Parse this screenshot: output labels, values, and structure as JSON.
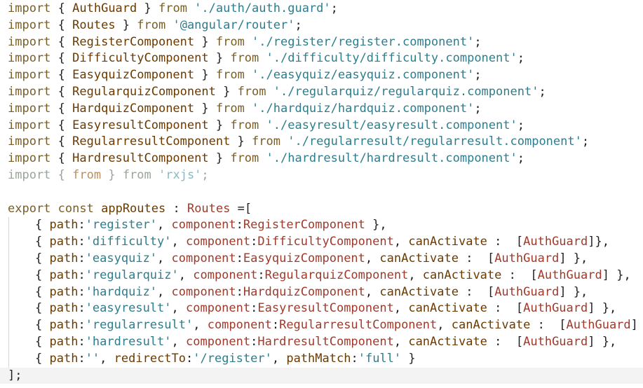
{
  "lines": [
    {
      "kind": "import",
      "keyword": "import",
      "open": " { ",
      "name": "AuthGuard",
      "close": " } ",
      "from": "from",
      "path": " './auth/auth.guard'",
      "end": ";"
    },
    {
      "kind": "import",
      "keyword": "import",
      "open": " { ",
      "name": "Routes",
      "close": " } ",
      "from": "from",
      "path": " '@angular/router'",
      "end": ";"
    },
    {
      "kind": "import",
      "keyword": "import",
      "open": " { ",
      "name": "RegisterComponent",
      "close": " } ",
      "from": "from",
      "path": " './register/register.component'",
      "end": ";"
    },
    {
      "kind": "import",
      "keyword": "import",
      "open": " { ",
      "name": "DifficultyComponent",
      "close": " } ",
      "from": "from",
      "path": " './difficulty/difficulty.component'",
      "end": ";"
    },
    {
      "kind": "import",
      "keyword": "import",
      "open": " { ",
      "name": "EasyquizComponent",
      "close": " } ",
      "from": "from",
      "path": " './easyquiz/easyquiz.component'",
      "end": ";"
    },
    {
      "kind": "import",
      "keyword": "import",
      "open": " { ",
      "name": "RegularquizComponent",
      "close": " } ",
      "from": "from",
      "path": " './regularquiz/regularquiz.component'",
      "end": ";"
    },
    {
      "kind": "import",
      "keyword": "import",
      "open": " { ",
      "name": "HardquizComponent",
      "close": " } ",
      "from": "from",
      "path": " './hardquiz/hardquiz.component'",
      "end": ";"
    },
    {
      "kind": "import",
      "keyword": "import",
      "open": " { ",
      "name": "EasyresultComponent",
      "close": " } ",
      "from": "from",
      "path": " './easyresult/easyresult.component'",
      "end": ";"
    },
    {
      "kind": "import",
      "keyword": "import",
      "open": " { ",
      "name": "RegularresultComponent",
      "close": " } ",
      "from": "from",
      "path": " './regularresult/regularresult.component'",
      "end": ";"
    },
    {
      "kind": "import",
      "keyword": "import",
      "open": " { ",
      "name": "HardresultComponent",
      "close": " } ",
      "from": "from",
      "path": " './hardresult/hardresult.component'",
      "end": ";"
    },
    {
      "kind": "import-dim",
      "keyword": "import",
      "open": " { ",
      "name": "from",
      "close": " } ",
      "from": "from",
      "path": " 'rxjs'",
      "end": ";"
    },
    {
      "kind": "blank"
    },
    {
      "kind": "export",
      "keyword": "export",
      "sp1": " ",
      "const": "const",
      "sp2": " ",
      "name": "appRoutes",
      "colon": " : ",
      "type": "Routes",
      "rest": " =["
    },
    {
      "kind": "route",
      "open": "{ ",
      "pathKey": "path",
      "pathColon": ":",
      "pathVal": "'register'",
      "sep1": ", ",
      "compKey": "component",
      "compColon": ":",
      "compVal": "RegisterComponent",
      "tail": " },"
    },
    {
      "kind": "route-guard",
      "open": "{ ",
      "pathKey": "path",
      "pathColon": ":",
      "pathVal": "'difficulty'",
      "sep1": ", ",
      "compKey": "component",
      "compColon": ":",
      "compVal": "DifficultyComponent",
      "sep2": ", ",
      "canKey": "canActivate",
      "canColon": " :  ",
      "lb": "[",
      "guard": "AuthGuard",
      "rb": "]",
      "tail": "},"
    },
    {
      "kind": "route-guard",
      "open": "{ ",
      "pathKey": "path",
      "pathColon": ":",
      "pathVal": "'easyquiz'",
      "sep1": ", ",
      "compKey": "component",
      "compColon": ":",
      "compVal": "EasyquizComponent",
      "sep2": ", ",
      "canKey": "canActivate",
      "canColon": " :  ",
      "lb": "[",
      "guard": "AuthGuard",
      "rb": "]",
      "tail": " },"
    },
    {
      "kind": "route-guard",
      "open": "{ ",
      "pathKey": "path",
      "pathColon": ":",
      "pathVal": "'regularquiz'",
      "sep1": ", ",
      "compKey": "component",
      "compColon": ":",
      "compVal": "RegularquizComponent",
      "sep2": ", ",
      "canKey": "canActivate",
      "canColon": " :  ",
      "lb": "[",
      "guard": "AuthGuard",
      "rb": "]",
      "tail": " },"
    },
    {
      "kind": "route-guard",
      "open": "{ ",
      "pathKey": "path",
      "pathColon": ":",
      "pathVal": "'hardquiz'",
      "sep1": ", ",
      "compKey": "component",
      "compColon": ":",
      "compVal": "HardquizComponent",
      "sep2": ", ",
      "canKey": "canActivate",
      "canColon": " :  ",
      "lb": "[",
      "guard": "AuthGuard",
      "rb": "]",
      "tail": " },"
    },
    {
      "kind": "route-guard",
      "open": "{ ",
      "pathKey": "path",
      "pathColon": ":",
      "pathVal": "'easyresult'",
      "sep1": ", ",
      "compKey": "component",
      "compColon": ":",
      "compVal": "EasyresultComponent",
      "sep2": ", ",
      "canKey": "canActivate",
      "canColon": " :  ",
      "lb": "[",
      "guard": "AuthGuard",
      "rb": "]",
      "tail": " },"
    },
    {
      "kind": "route-guard",
      "open": "{ ",
      "pathKey": "path",
      "pathColon": ":",
      "pathVal": "'regularresult'",
      "sep1": ", ",
      "compKey": "component",
      "compColon": ":",
      "compVal": "RegularresultComponent",
      "sep2": ", ",
      "canKey": "canActivate",
      "canColon": " :  ",
      "lb": "[",
      "guard": "AuthGuard",
      "rb": "]",
      "tail": " },"
    },
    {
      "kind": "route-guard",
      "open": "{ ",
      "pathKey": "path",
      "pathColon": ":",
      "pathVal": "'hardresult'",
      "sep1": ", ",
      "compKey": "component",
      "compColon": ":",
      "compVal": "HardresultComponent",
      "sep2": ", ",
      "canKey": "canActivate",
      "canColon": " :  ",
      "lb": "[",
      "guard": "AuthGuard",
      "rb": "]",
      "tail": " },"
    },
    {
      "kind": "route-redirect",
      "open": "{ ",
      "pathKey": "path",
      "pathColon": ":",
      "pathVal": "''",
      "sep1": ", ",
      "redKey": "redirectTo",
      "redColon": ":",
      "redVal": "'/register'",
      "sep2": ", ",
      "pmKey": "pathMatch",
      "pmColon": ":",
      "pmVal": "'full'",
      "tail": " }"
    },
    {
      "kind": "close",
      "text": "];"
    }
  ],
  "colors": {
    "keyword": "#795e26",
    "string": "#2e7d8c",
    "identifier": "#6b3a00",
    "type": "#a03a2a",
    "background": "#ffffff",
    "current_line": "#f3f3f3"
  }
}
